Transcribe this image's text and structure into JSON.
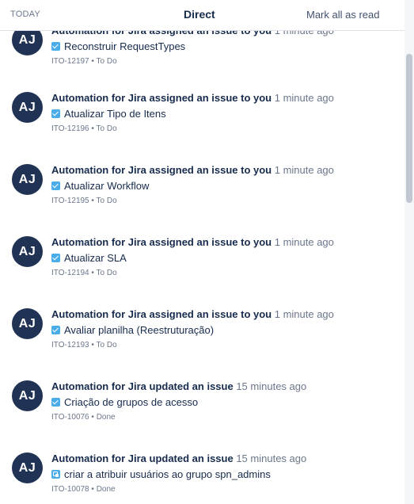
{
  "header": {
    "section_label": "TODAY",
    "tab_label": "Direct",
    "mark_all_label": "Mark all as read"
  },
  "notifications": [
    {
      "avatar_initials": "AJ",
      "actor": "Automation for Jira assigned an issue to you",
      "time": "1 minute ago",
      "issue_type_icon": "task-check-icon",
      "summary": "Reconstruir RequestTypes",
      "key": "ITO-12197",
      "status": "To Do"
    },
    {
      "avatar_initials": "AJ",
      "actor": "Automation for Jira assigned an issue to you",
      "time": "1 minute ago",
      "issue_type_icon": "task-check-icon",
      "summary": "Atualizar Tipo de Itens",
      "key": "ITO-12196",
      "status": "To Do"
    },
    {
      "avatar_initials": "AJ",
      "actor": "Automation for Jira assigned an issue to you",
      "time": "1 minute ago",
      "issue_type_icon": "task-check-icon",
      "summary": "Atualizar Workflow",
      "key": "ITO-12195",
      "status": "To Do"
    },
    {
      "avatar_initials": "AJ",
      "actor": "Automation for Jira assigned an issue to you",
      "time": "1 minute ago",
      "issue_type_icon": "task-check-icon",
      "summary": "Atualizar SLA",
      "key": "ITO-12194",
      "status": "To Do"
    },
    {
      "avatar_initials": "AJ",
      "actor": "Automation for Jira assigned an issue to you",
      "time": "1 minute ago",
      "issue_type_icon": "task-check-icon",
      "summary": "Avaliar planilha (Reestruturação)",
      "key": "ITO-12193",
      "status": "To Do"
    },
    {
      "avatar_initials": "AJ",
      "actor": "Automation for Jira updated an issue",
      "time": "15 minutes ago",
      "issue_type_icon": "task-check-icon",
      "summary": "Criação de grupos de acesso",
      "key": "ITO-10076",
      "status": "Done"
    },
    {
      "avatar_initials": "AJ",
      "actor": "Automation for Jira updated an issue",
      "time": "15 minutes ago",
      "issue_type_icon": "subtask-icon",
      "summary": "criar a atribuir usuários ao grupo spn_admins",
      "key": "ITO-10078",
      "status": "Done"
    }
  ],
  "separator": " • ",
  "colors": {
    "avatar_bg": "#203354",
    "issue_icon": "#4bade8",
    "text_primary": "#172b4d",
    "text_secondary": "#6b778c"
  }
}
